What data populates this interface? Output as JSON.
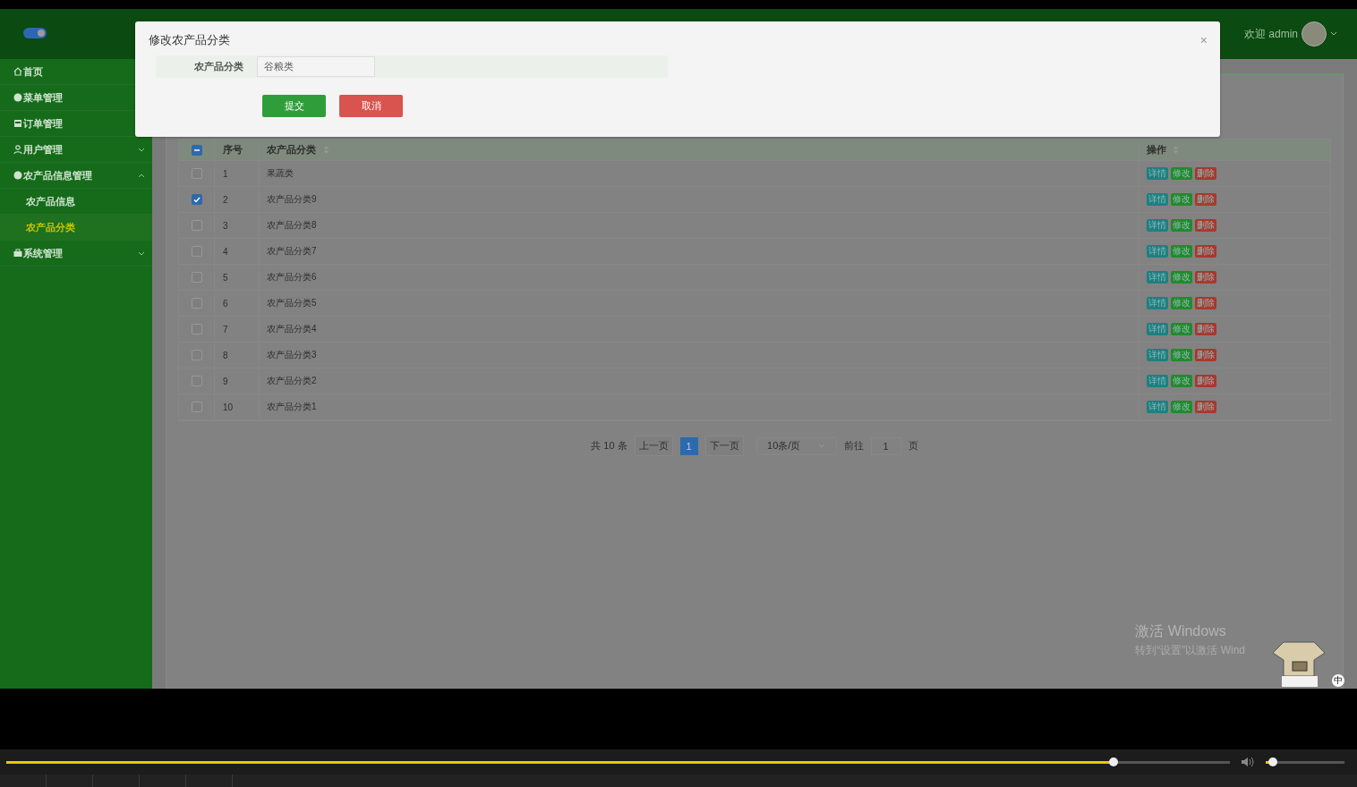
{
  "header": {
    "sidebar_toggle_on": true,
    "welcome": "欢迎 admin"
  },
  "sidebar": {
    "items": [
      {
        "label": "首页",
        "kind": "link"
      },
      {
        "label": "菜单管理",
        "kind": "link"
      },
      {
        "label": "订单管理",
        "kind": "link"
      },
      {
        "label": "用户管理",
        "kind": "group",
        "expanded": false
      },
      {
        "label": "农产品信息管理",
        "kind": "group",
        "expanded": true,
        "children": [
          {
            "label": "农产品信息",
            "selected": false
          },
          {
            "label": "农产品分类",
            "selected": true
          }
        ]
      },
      {
        "label": "系统管理",
        "kind": "group",
        "expanded": false
      }
    ]
  },
  "table": {
    "header_checkbox": {
      "indeterminate": true
    },
    "columns": [
      {
        "label": "序号",
        "sortable": false
      },
      {
        "label": "农产品分类",
        "sortable": true
      },
      {
        "label": "操作",
        "sortable": true
      }
    ],
    "rows": [
      {
        "index": "1",
        "name": "果蔬类",
        "checked": false,
        "actions": [
          {
            "label": "详情",
            "kind": "info"
          },
          {
            "label": "修改",
            "kind": "edit"
          },
          {
            "label": "删除",
            "kind": "delete"
          }
        ]
      },
      {
        "index": "2",
        "name": "农产品分类9",
        "checked": true,
        "actions": [
          {
            "label": "详情",
            "kind": "info"
          },
          {
            "label": "修改",
            "kind": "edit"
          },
          {
            "label": "删除",
            "kind": "delete"
          }
        ]
      },
      {
        "index": "3",
        "name": "农产品分类8",
        "checked": false,
        "actions": [
          {
            "label": "详情",
            "kind": "info"
          },
          {
            "label": "修改",
            "kind": "edit"
          },
          {
            "label": "删除",
            "kind": "delete"
          }
        ]
      },
      {
        "index": "4",
        "name": "农产品分类7",
        "checked": false,
        "actions": [
          {
            "label": "详情",
            "kind": "info"
          },
          {
            "label": "修改",
            "kind": "edit"
          },
          {
            "label": "删除",
            "kind": "delete"
          }
        ]
      },
      {
        "index": "5",
        "name": "农产品分类6",
        "checked": false,
        "actions": [
          {
            "label": "详情",
            "kind": "info"
          },
          {
            "label": "修改",
            "kind": "edit"
          },
          {
            "label": "删除",
            "kind": "delete"
          }
        ]
      },
      {
        "index": "6",
        "name": "农产品分类5",
        "checked": false,
        "actions": [
          {
            "label": "详情",
            "kind": "info"
          },
          {
            "label": "修改",
            "kind": "edit"
          },
          {
            "label": "删除",
            "kind": "delete"
          }
        ]
      },
      {
        "index": "7",
        "name": "农产品分类4",
        "checked": false,
        "actions": [
          {
            "label": "详情",
            "kind": "info"
          },
          {
            "label": "修改",
            "kind": "edit"
          },
          {
            "label": "删除",
            "kind": "delete"
          }
        ]
      },
      {
        "index": "8",
        "name": "农产品分类3",
        "checked": false,
        "actions": [
          {
            "label": "详情",
            "kind": "info"
          },
          {
            "label": "修改",
            "kind": "edit"
          },
          {
            "label": "删除",
            "kind": "delete"
          }
        ]
      },
      {
        "index": "9",
        "name": "农产品分类2",
        "checked": false,
        "actions": [
          {
            "label": "详情",
            "kind": "info"
          },
          {
            "label": "修改",
            "kind": "edit"
          },
          {
            "label": "删除",
            "kind": "delete"
          }
        ]
      },
      {
        "index": "10",
        "name": "农产品分类1",
        "checked": false,
        "actions": [
          {
            "label": "详情",
            "kind": "info"
          },
          {
            "label": "修改",
            "kind": "edit"
          },
          {
            "label": "删除",
            "kind": "delete"
          }
        ]
      }
    ]
  },
  "pagination": {
    "total": "共 10 条",
    "prev": "上一页",
    "pages": [
      {
        "label": "1",
        "selected": true
      }
    ],
    "next": "下一页",
    "page_size": "10条/页",
    "goto_label": "前往",
    "goto_value": "1",
    "goto_suffix": "页"
  },
  "modal": {
    "title": "修改农产品分类",
    "close": "×",
    "field_label": "农产品分类",
    "field_value": "谷粮类",
    "buttons": [
      {
        "label": "提交",
        "kind": "primary"
      },
      {
        "label": "取消",
        "kind": "danger"
      }
    ]
  },
  "activation_notice": {
    "title": "激活 Windows",
    "subtitle": "转到“设置”以激活 Wind"
  },
  "tray": {
    "ime": "中"
  },
  "player": {
    "progress": {
      "level": 0.905
    },
    "volume": {
      "level": 0.09
    }
  }
}
